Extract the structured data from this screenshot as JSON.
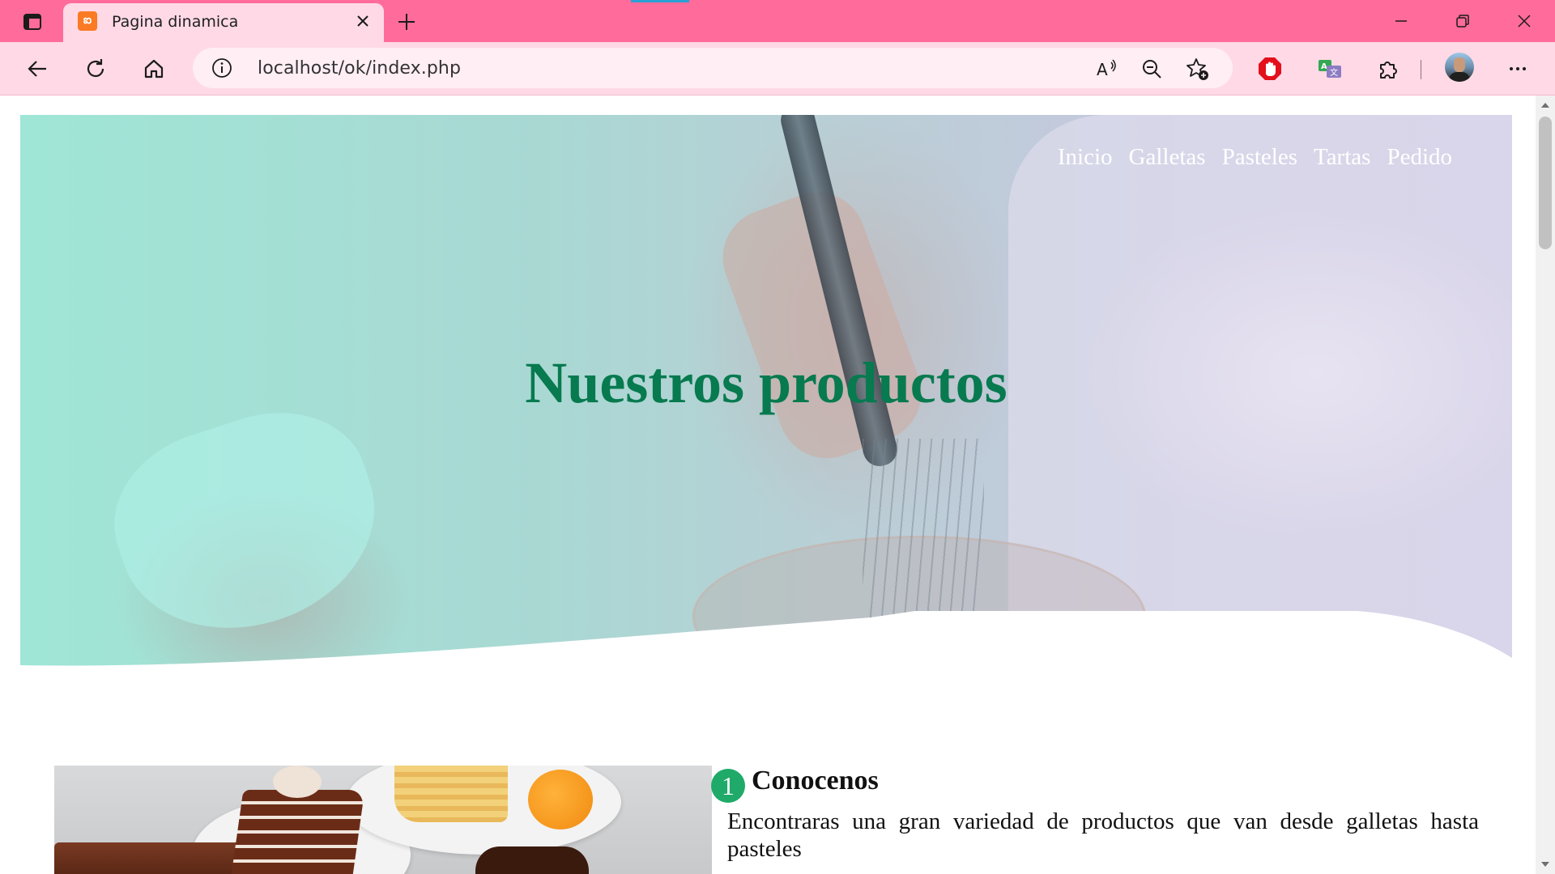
{
  "browser": {
    "tab_title": "Pagina dinamica",
    "favicon_icon": "xampp-icon",
    "url": "localhost/ok/index.php",
    "colors": {
      "titlebar": "#ff6b9a",
      "toolbar": "#ffd9e6",
      "tab": "#ffd9e6"
    }
  },
  "hero": {
    "nav": [
      "Inicio",
      "Galletas",
      "Pasteles",
      "Tartas",
      "Pedido"
    ],
    "title": "Nuestros productos",
    "title_color": "#077a4f"
  },
  "section": {
    "number": "1",
    "title": "Conocenos",
    "text": "Encontraras una gran variedad de productos que van desde galletas hasta pasteles",
    "badge_color": "#1faa69"
  }
}
